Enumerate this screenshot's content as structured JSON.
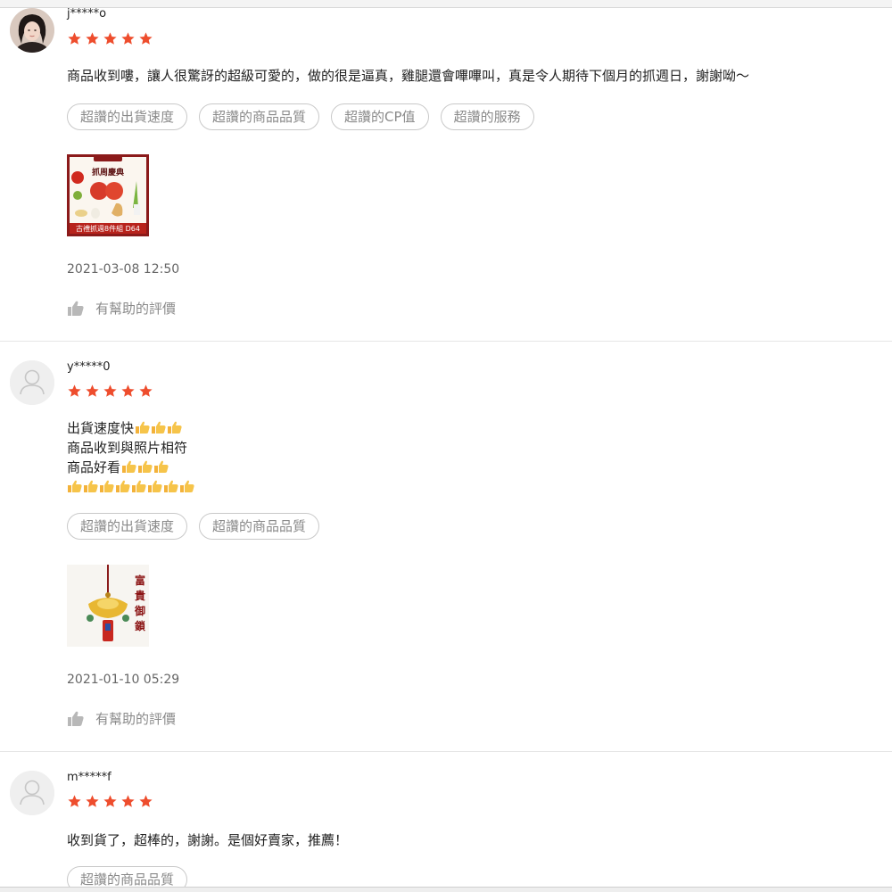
{
  "colors": {
    "star": "#ee4d2d",
    "tag_border": "#c9c9c9",
    "tag_text": "#8a8a8a",
    "divider": "#e6e6e6"
  },
  "reviews": [
    {
      "username": "j*****o",
      "rating": 5,
      "avatar": "user-photo",
      "comment_lines": [
        "商品收到嘍，讓人很驚訝的超級可愛的，做的很是逼真，雞腿還會嗶嗶叫，真是令人期待下個月的抓週日，謝謝呦～"
      ],
      "tags": [
        "超讚的出貨速度",
        "超讚的商品品質",
        "超讚的CP值",
        "超讚的服務"
      ],
      "image_label": "古禮抓週8件組 D64",
      "image_title": "抓周慶典",
      "timestamp": "2021-03-08 12:50",
      "helpful_label": "有幫助的評價"
    },
    {
      "username": "y*****0",
      "rating": 5,
      "avatar": "default-user",
      "comment_lines": [
        "出貨速度快",
        "商品收到與照片相符",
        "商品好看",
        ""
      ],
      "tags": [
        "超讚的出貨速度",
        "超讚的商品品質"
      ],
      "image_title": "富貴御鎖",
      "timestamp": "2021-01-10 05:29",
      "helpful_label": "有幫助的評價"
    },
    {
      "username": "m*****f",
      "rating": 5,
      "avatar": "default-user",
      "comment_lines": [
        "收到貨了，超棒的，謝謝。是個好賣家，推薦！"
      ],
      "tags": [
        "超讚的商品品質"
      ]
    }
  ]
}
